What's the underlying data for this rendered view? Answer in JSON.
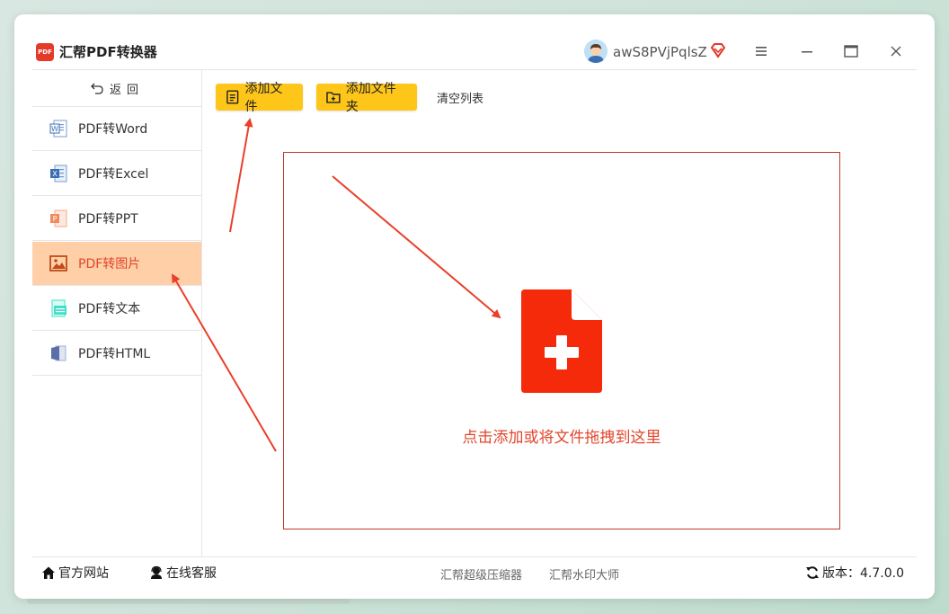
{
  "app": {
    "logo_text": "PDF",
    "title": "汇帮PDF转换器"
  },
  "user": {
    "name": "awS8PVjPqlsZ"
  },
  "sidebar": {
    "back_label": "返回",
    "items": [
      {
        "label": "PDF转Word",
        "icon": "word-icon",
        "active": false
      },
      {
        "label": "PDF转Excel",
        "icon": "excel-icon",
        "active": false
      },
      {
        "label": "PDF转PPT",
        "icon": "ppt-icon",
        "active": false
      },
      {
        "label": "PDF转图片",
        "icon": "image-icon",
        "active": true
      },
      {
        "label": "PDF转文本",
        "icon": "text-icon",
        "active": false
      },
      {
        "label": "PDF转HTML",
        "icon": "html-icon",
        "active": false
      }
    ]
  },
  "toolbar": {
    "add_file": "添加文件",
    "add_folder": "添加文件夹",
    "clear_list": "清空列表"
  },
  "drop_zone": {
    "hint": "点击添加或将文件拖拽到这里"
  },
  "footer": {
    "website": "官方网站",
    "support": "在线客服",
    "link1": "汇帮超级压缩器",
    "link2": "汇帮水印大师",
    "version": "版本：4.7.0.0"
  },
  "colors": {
    "accent_yellow": "#ffc61a",
    "active_bg": "#ffcfa8",
    "active_text": "#e2452b",
    "drop_icon": "#f52a0a",
    "arrow": "#e8402a"
  }
}
